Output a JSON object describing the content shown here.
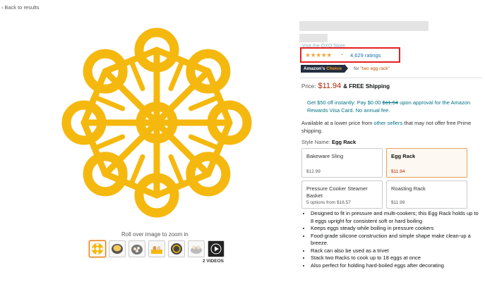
{
  "nav": {
    "back_label": "Back to results"
  },
  "gallery": {
    "zoom_hint": "Roll over image to zoom in",
    "videos_label": "2 VIDEOS",
    "thumbnails": [
      "egg-rack",
      "pressure-cooker",
      "pressure-cooker-eggs",
      "eggs-rack-hand",
      "rack-in-pot",
      "cooked-eggs",
      "video"
    ]
  },
  "product": {
    "store_link": "Visit the OXO Store",
    "rating_stars": "★★★★★",
    "rating_value": 4.5,
    "ratings_count": "4,629 ratings",
    "choice_badge_pre": "Amazon's",
    "choice_badge_post": "Choice",
    "choice_for": "for",
    "choice_query": "\"two egg rack\"",
    "price_label": "Price:",
    "price": "$11.94",
    "shipping": "& FREE Shipping",
    "promo_pre": "Get $50 off instantly: Pay $0.00",
    "promo_strike": "$11.94",
    "promo_post": "upon approval for the Amazon Rewards Visa Card. No annual fee.",
    "lower_pre": "Available at a lower price from",
    "lower_link": "other sellers",
    "lower_post": "that may not offer free Prime shipping.",
    "style_label": "Style Name:",
    "style_value": "Egg Rack"
  },
  "styles": [
    {
      "name": "Bakeware Sling",
      "price": "$12.99"
    },
    {
      "name": "Egg Rack",
      "price": "$11.94",
      "selected": true
    },
    {
      "name": "Pressure Cooker Steamer Basket",
      "price": "5 options from $16.57"
    },
    {
      "name": "Roasting Rack",
      "price": "$11.99"
    }
  ],
  "bullets": [
    "Designed to fit in pressure and multi-cookers; this Egg Rack holds up to 8 eggs upright for consistent soft or hard boiling",
    "Keeps eggs steady while boiling in pressure cookers",
    "Food-grade silicone construction and simple shape make clean-up a breeze.",
    "Rack can also be used as a trivet",
    "Stack two Racks to cook up to 18 eggs at once",
    "Also perfect for holding hard-boiled eggs after decorating"
  ],
  "colors": {
    "accent_red": "#e52020",
    "price": "#b12704",
    "link": "#007185",
    "star": "#f2a742",
    "product_yellow": "#f5b80e"
  }
}
